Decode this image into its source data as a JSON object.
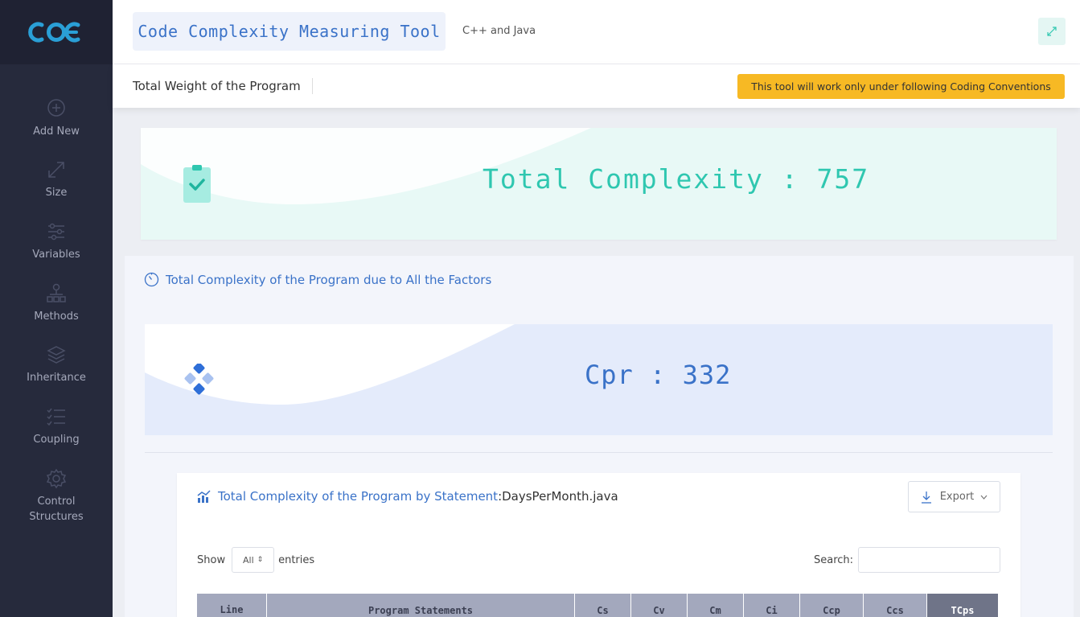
{
  "app": {
    "title": "Code Complexity Measuring Tool",
    "subtitle": "C++ and Java",
    "logo_text": "CDE"
  },
  "sidebar": {
    "items": [
      {
        "label": "Add New",
        "icon": "plus-circle-icon"
      },
      {
        "label": "Size",
        "icon": "expand-arrows-icon"
      },
      {
        "label": "Variables",
        "icon": "sliders-icon"
      },
      {
        "label": "Methods",
        "icon": "hierarchy-icon"
      },
      {
        "label": "Inheritance",
        "icon": "layers-icon"
      },
      {
        "label": "Coupling",
        "icon": "checklist-icon"
      },
      {
        "label": "Control Structures",
        "icon": "gear-icon"
      }
    ]
  },
  "subheader": {
    "title": "Total Weight of the Program",
    "warning": "This tool will work only under following Coding Conventions"
  },
  "total": {
    "text": "Total Complexity : 757"
  },
  "panel": {
    "title": "Total Complexity of the Program due to All the Factors",
    "cpr_text": "Cpr : 332"
  },
  "table_card": {
    "title": "Total Complexity of the Program by Statement",
    "separator": " : ",
    "file": "DaysPerMonth.java",
    "export_label": "Export",
    "show_label": "Show",
    "entries_label": "entries",
    "page_size": "All",
    "search_label": "Search:",
    "search_value": "",
    "columns": [
      {
        "label": "Line\nNo",
        "width": 87
      },
      {
        "label": "Program Statements",
        "width": 383
      },
      {
        "label": "Cs",
        "width": 70
      },
      {
        "label": "Cv",
        "width": 70
      },
      {
        "label": "Cm",
        "width": 70
      },
      {
        "label": "Ci",
        "width": 70
      },
      {
        "label": "Ccp",
        "width": 79
      },
      {
        "label": "Ccs",
        "width": 79
      },
      {
        "label": "TCps",
        "width": 89
      }
    ]
  },
  "colors": {
    "sidebar_bg": "#262a3c",
    "accent_blue": "#3a72c8",
    "accent_teal": "#2fc7b0",
    "warning": "#f7b924"
  }
}
